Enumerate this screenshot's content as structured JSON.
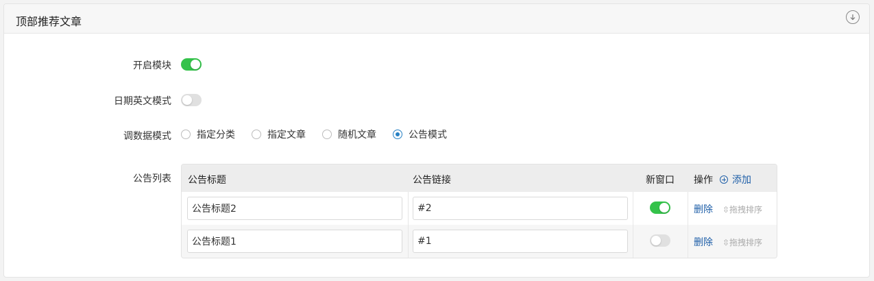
{
  "panel": {
    "title": "顶部推荐文章",
    "collapse_icon": "circle-arrow-down-icon"
  },
  "settings": {
    "module_label": "开启模块",
    "module_enabled": true,
    "date_english_label": "日期英文模式",
    "date_english_enabled": false,
    "data_mode_label": "调数据模式",
    "data_mode_options": [
      "指定分类",
      "指定文章",
      "随机文章",
      "公告模式"
    ],
    "data_mode_selected": "公告模式"
  },
  "notice_list": {
    "label": "公告列表",
    "headers": {
      "title": "公告标题",
      "link": "公告链接",
      "new_window": "新窗口",
      "actions": "操作",
      "add": "添加"
    },
    "rows": [
      {
        "title": "公告标题2",
        "link": "#2",
        "new_window": true,
        "delete": "删除",
        "drag": "⇳拖拽排序"
      },
      {
        "title": "公告标题1",
        "link": "#1",
        "new_window": false,
        "delete": "删除",
        "drag": "⇳拖拽排序"
      }
    ]
  },
  "colors": {
    "switch_on": "#34c24a",
    "switch_off": "#e0e0e0",
    "link": "#1f5fa8",
    "radio_checked": "#2680c4"
  }
}
